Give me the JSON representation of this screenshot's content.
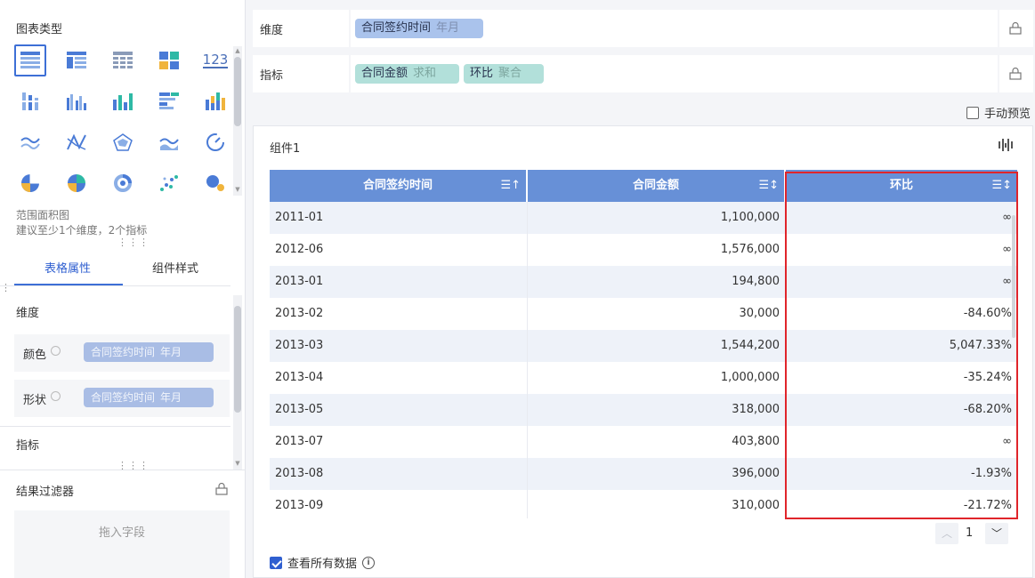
{
  "left_panel": {
    "chart_type_title": "图表类型",
    "number_icon_label": "123",
    "selected_chart_name": "范围面积图",
    "chart_requirement": "建议至少1个维度，2个指标",
    "tabs": [
      {
        "label": "表格属性",
        "active": true
      },
      {
        "label": "组件样式",
        "active": false
      }
    ],
    "dimension_section": "维度",
    "color_row": {
      "label": "颜色",
      "field": "合同签约时间",
      "sub": "年月"
    },
    "shape_row": {
      "label": "形状",
      "field": "合同签约时间",
      "sub": "年月"
    },
    "metric_section": "指标",
    "filter_title": "结果过滤器",
    "drop_zone": "拖入字段"
  },
  "dimension_bar": {
    "label": "维度",
    "chips": [
      {
        "name": "合同签约时间",
        "sub": "年月"
      }
    ]
  },
  "metric_bar": {
    "label": "指标",
    "chips": [
      {
        "name": "合同金额",
        "sub": "求和"
      },
      {
        "name": "环比",
        "sub": "聚合"
      }
    ]
  },
  "manual_preview": {
    "label": "手动预览",
    "checked": false
  },
  "widget": {
    "title": "组件1",
    "table": {
      "headers": [
        "合同签约时间",
        "合同金额",
        "环比"
      ],
      "rows": [
        [
          "2011-01",
          "1,100,000",
          "∞"
        ],
        [
          "2012-06",
          "1,576,000",
          "∞"
        ],
        [
          "2013-01",
          "194,800",
          "∞"
        ],
        [
          "2013-02",
          "30,000",
          "-84.60%"
        ],
        [
          "2013-03",
          "1,544,200",
          "5,047.33%"
        ],
        [
          "2013-04",
          "1,000,000",
          "-35.24%"
        ],
        [
          "2013-05",
          "318,000",
          "-68.20%"
        ],
        [
          "2013-07",
          "403,800",
          "∞"
        ],
        [
          "2013-08",
          "396,000",
          "-1.93%"
        ],
        [
          "2013-09",
          "310,000",
          "-21.72%"
        ]
      ]
    },
    "page": "1",
    "view_all": {
      "label": "查看所有数据",
      "checked": true
    }
  },
  "colors": {
    "accent": "#2f5fd0",
    "header_blue": "#6790d7",
    "highlight_red": "#e0252b",
    "chip_blue": "#aac3ec",
    "chip_teal": "#b2e0da"
  }
}
